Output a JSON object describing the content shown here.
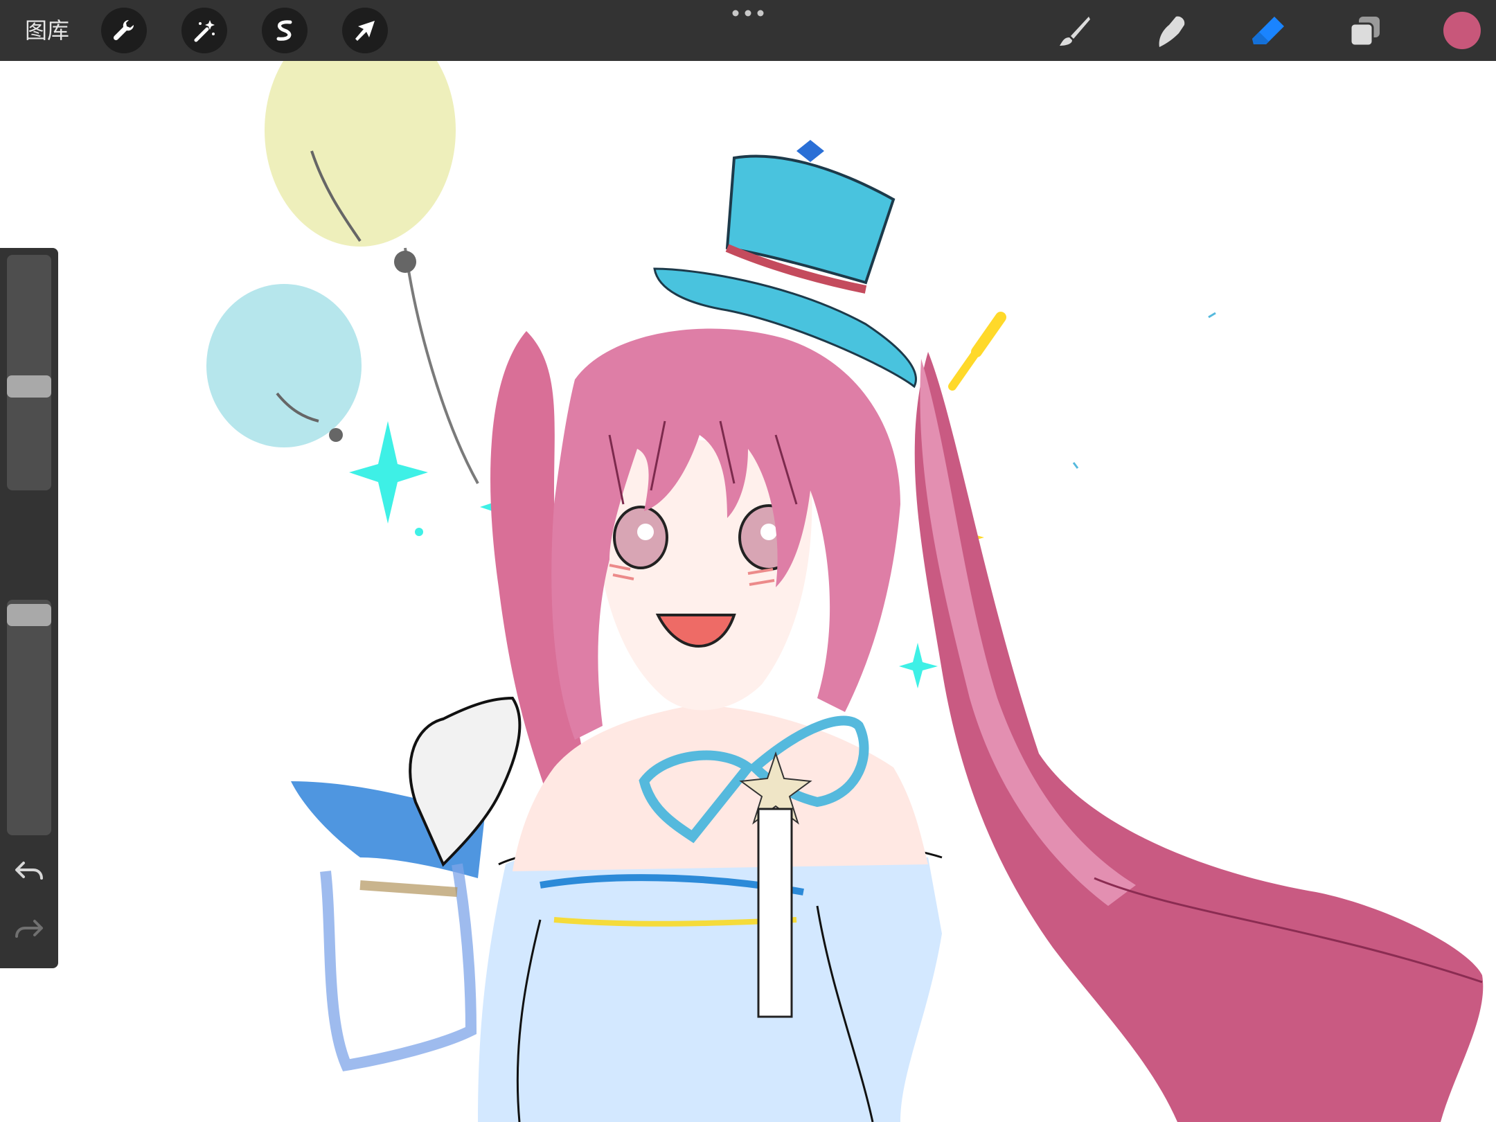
{
  "toolbar": {
    "gallery_label": "图库",
    "left_tools": [
      {
        "icon": "wrench-icon",
        "name": "actions"
      },
      {
        "icon": "magic-wand-icon",
        "name": "adjustments"
      },
      {
        "icon": "selection-s-icon",
        "name": "selection"
      },
      {
        "icon": "transform-arrow-icon",
        "name": "transform"
      }
    ],
    "center_icon": "more-dots-icon",
    "right_tools": [
      {
        "icon": "brush-icon",
        "name": "paint",
        "active": false
      },
      {
        "icon": "smudge-icon",
        "name": "smudge",
        "active": false
      },
      {
        "icon": "eraser-icon",
        "name": "erase",
        "active": true
      },
      {
        "icon": "layers-icon",
        "name": "layers",
        "active": false
      }
    ],
    "current_color": "#c8577a",
    "active_tool_color": "#1a84ff"
  },
  "sidebar": {
    "brush_size_level": 0.58,
    "opacity_level": 0.98,
    "modify_icon": "square-modify-icon",
    "undo_icon": "undo-icon",
    "redo_icon": "redo-icon"
  },
  "canvas": {
    "subject": "anime-girl-illustration"
  }
}
